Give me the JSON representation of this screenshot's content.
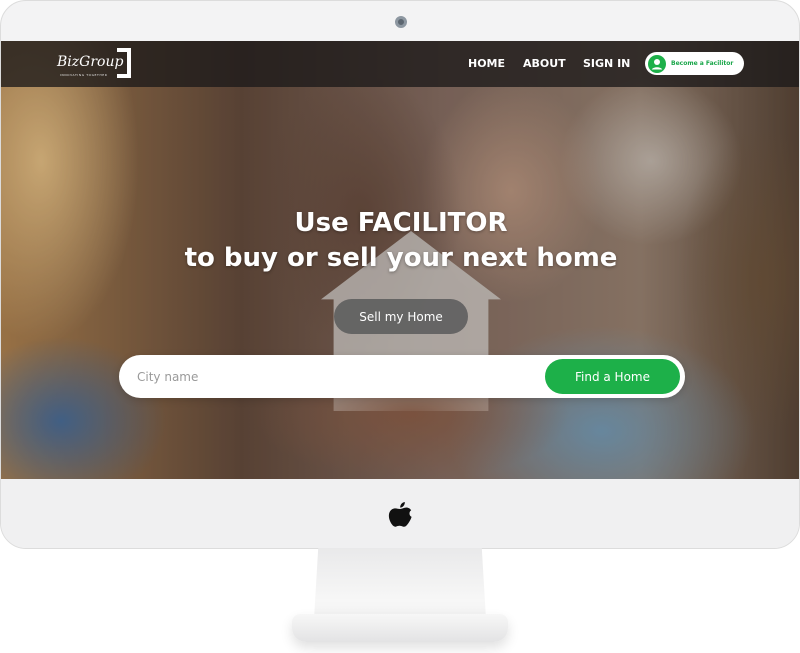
{
  "brand": {
    "name": "BizGroup",
    "tagline": "INNOVATING TOGETHER"
  },
  "nav": {
    "items": [
      {
        "label": "HOME"
      },
      {
        "label": "ABOUT"
      },
      {
        "label": "SIGN IN"
      }
    ],
    "cta_label": "Become a Facilitor"
  },
  "hero": {
    "line1": "Use FACILITOR",
    "line2": "to buy or sell your next home",
    "sell_button": "Sell my Home"
  },
  "search": {
    "placeholder": "City name",
    "value": "",
    "button_label": "Find a Home"
  },
  "icons": {
    "user": "user-circle-icon",
    "apple": "apple-logo-icon",
    "camera": "camera-icon"
  },
  "colors": {
    "accent_green": "#1db049",
    "nav_background": "#1c1a19",
    "sell_button": "#5f5f5f"
  }
}
